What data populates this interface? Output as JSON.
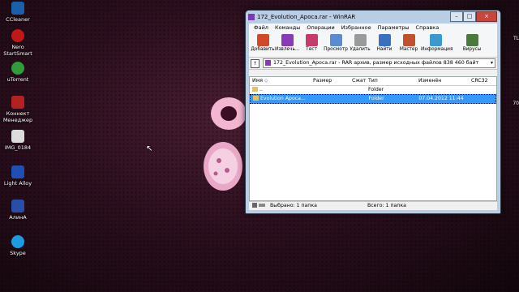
{
  "desktop": {
    "icons": [
      {
        "label": "CCleaner",
        "icon": "ccleaner-icon"
      },
      {
        "label": "Nero StartSmart",
        "icon": "nero-icon"
      },
      {
        "label": "uTorrent",
        "icon": "utorrent-icon"
      },
      {
        "label": "Коннект Менеджер",
        "icon": "connect-manager-icon"
      },
      {
        "label": "IMG_0184",
        "icon": "image-file-icon"
      },
      {
        "label": "Light Alloy",
        "icon": "light-alloy-icon"
      },
      {
        "label": "АлинА",
        "icon": "alina-icon"
      },
      {
        "label": "Skype",
        "icon": "skype-icon"
      }
    ],
    "right_edge_1": "TL",
    "right_edge_2": "70"
  },
  "window": {
    "title": "172_Evolution_Apoca.rar - WinRAR",
    "menu": [
      "Файл",
      "Команды",
      "Операции",
      "Избранное",
      "Параметры",
      "Справка"
    ],
    "toolbar": [
      {
        "label": "Добавить",
        "color": "#d04a2a"
      },
      {
        "label": "Извлечь...",
        "color": "#8a3ab8"
      },
      {
        "label": "Тест",
        "color": "#c83a6a"
      },
      {
        "label": "Просмотр",
        "color": "#5a8ad0"
      },
      {
        "label": "Удалить",
        "color": "#9a9a9a"
      },
      {
        "label": "Найти",
        "color": "#3a70c0"
      },
      {
        "label": "Мастер",
        "color": "#c05030"
      },
      {
        "label": "Информация",
        "color": "#3a9ad0"
      },
      {
        "label": "Вирусы",
        "color": "#4a7a3a"
      }
    ],
    "path": "172_Evolution_Apoca.rar - RAR архив, размер исходных файлов 838 460 байт",
    "columns": {
      "name": "Имя",
      "size": "Размер",
      "packed": "Сжат",
      "type": "Тип",
      "modified": "Изменён",
      "crc": "CRC32"
    },
    "rows": [
      {
        "name": "..",
        "size": "",
        "packed": "",
        "type": "Folder",
        "modified": "",
        "crc": ""
      },
      {
        "name": "Evolution Apoca...",
        "size": "",
        "packed": "",
        "type": "Folder",
        "modified": "07.04.2012 11:44",
        "crc": ""
      }
    ],
    "status_left": "Выбрано: 1 папка",
    "status_right": "Всего: 1 папка"
  }
}
